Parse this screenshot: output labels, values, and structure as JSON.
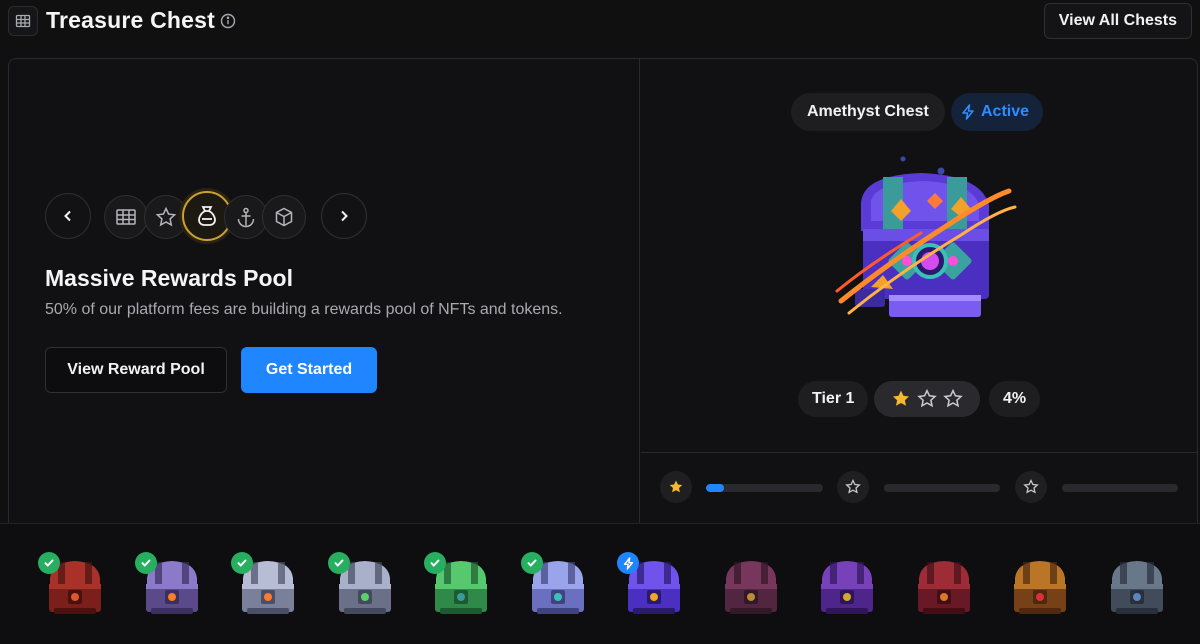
{
  "header": {
    "title": "Treasure Chest",
    "view_all_label": "View All Chests"
  },
  "feature": {
    "title": "Massive Rewards Pool",
    "description": "50% of our platform fees are building a rewards pool of NFTs and tokens.",
    "secondary_button": "View Reward Pool",
    "primary_button": "Get Started",
    "icons": [
      "treasure-map-icon",
      "star-icon",
      "money-bag-icon",
      "anchor-icon",
      "cube-icon"
    ],
    "active_index": 2
  },
  "chest": {
    "name": "Amethyst Chest",
    "status": "Active",
    "tier_label": "Tier 1",
    "stars_filled": 1,
    "stars_total": 3,
    "percent_label": "4%",
    "progress": [
      0.15,
      0,
      0
    ]
  },
  "colors": {
    "accent": "#1f86ff",
    "star": "#f5b82e",
    "check": "#27ae60",
    "active_ring": "#c9a233"
  },
  "chest_strip": [
    {
      "theme": "crimson",
      "status": "completed"
    },
    {
      "theme": "violet-orange",
      "status": "completed"
    },
    {
      "theme": "silver-orange",
      "status": "completed"
    },
    {
      "theme": "steel-green",
      "status": "completed"
    },
    {
      "theme": "emerald",
      "status": "completed"
    },
    {
      "theme": "lavender-teal",
      "status": "completed"
    },
    {
      "theme": "amethyst",
      "status": "active"
    },
    {
      "theme": "plum-gold",
      "status": "locked"
    },
    {
      "theme": "royal-purple",
      "status": "locked"
    },
    {
      "theme": "ruby",
      "status": "locked"
    },
    {
      "theme": "golden",
      "status": "locked"
    },
    {
      "theme": "slate-blue",
      "status": "locked"
    }
  ]
}
